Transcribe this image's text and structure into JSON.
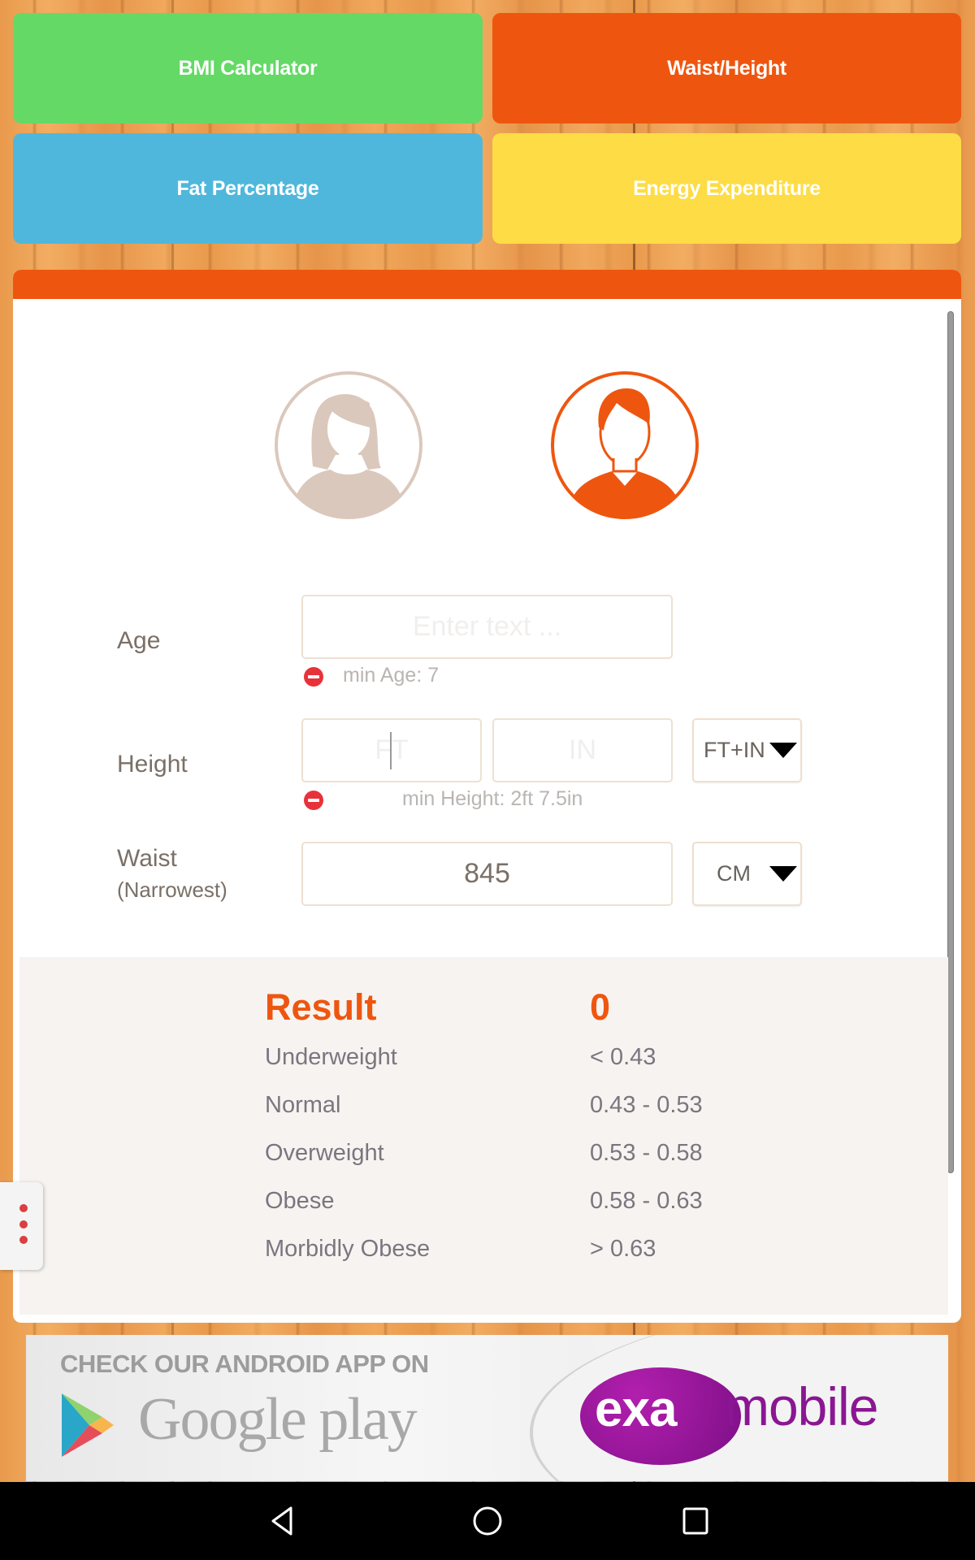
{
  "tabs": {
    "bmi": "BMI Calculator",
    "waist_height": "Waist/Height",
    "fat": "Fat Percentage",
    "energy": "Energy Expenditure"
  },
  "colors": {
    "accent": "#ee560f",
    "bmi": "#64d966",
    "fat": "#50b7dc",
    "energy": "#fddc45",
    "female_inactive": "#dbc8bc"
  },
  "gender": {
    "female": {
      "icon": "female-avatar-icon",
      "selected": false
    },
    "male": {
      "icon": "male-avatar-icon",
      "selected": true
    }
  },
  "form": {
    "age": {
      "label": "Age",
      "value": "",
      "placeholder": "Enter text ...",
      "hint": "min Age: 7"
    },
    "height": {
      "label": "Height",
      "ft_value": "",
      "ft_placeholder": "FT",
      "in_value": "",
      "in_placeholder": "IN",
      "unit": "FT+IN",
      "hint": "min Height: 2ft 7.5in"
    },
    "waist": {
      "label": "Waist",
      "sublabel": "(Narrowest)",
      "value": "845",
      "unit": "CM"
    }
  },
  "result": {
    "title": "Result",
    "value": "0",
    "rows": [
      {
        "label": "Underweight",
        "range": "< 0.43"
      },
      {
        "label": "Normal",
        "range": "0.43 - 0.53"
      },
      {
        "label": "Overweight",
        "range": "0.53 - 0.58"
      },
      {
        "label": "Obese",
        "range": "0.58 - 0.63"
      },
      {
        "label": "Morbidly Obese",
        "range": "> 0.63"
      }
    ]
  },
  "ad": {
    "top_text": "CHECK OUR ANDROID APP ON",
    "store_text": "Google play",
    "brand_exa": "exa",
    "brand_mobile": "mobile"
  },
  "system_nav": {
    "back": "back-icon",
    "home": "home-icon",
    "recents": "recents-icon"
  }
}
